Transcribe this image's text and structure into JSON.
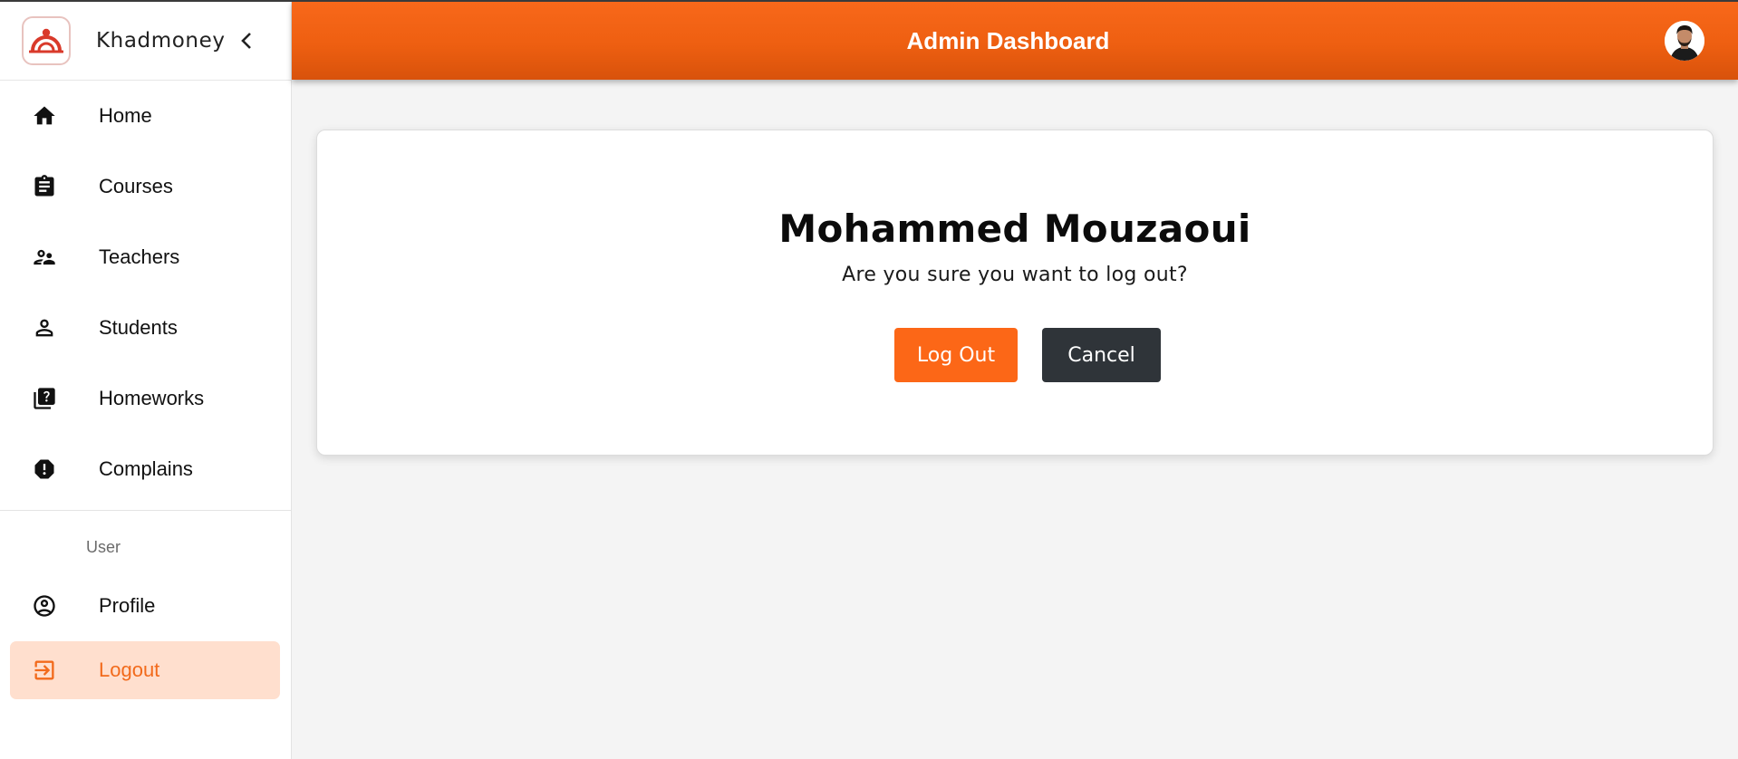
{
  "brand": {
    "name": "Khadmoney"
  },
  "header": {
    "title": "Admin Dashboard"
  },
  "nav": {
    "items": [
      {
        "label": "Home",
        "icon": "home-icon"
      },
      {
        "label": "Courses",
        "icon": "clipboard-icon"
      },
      {
        "label": "Teachers",
        "icon": "people-icon"
      },
      {
        "label": "Students",
        "icon": "person-icon"
      },
      {
        "label": "Homeworks",
        "icon": "quiz-icon"
      },
      {
        "label": "Complains",
        "icon": "report-icon"
      }
    ],
    "section_label": "User",
    "user_items": [
      {
        "label": "Profile",
        "icon": "account-circle-icon"
      },
      {
        "label": "Logout",
        "icon": "logout-icon",
        "active": true
      }
    ]
  },
  "dialog": {
    "name": "Mohammed Mouzaoui",
    "message": "Are you sure you want to log out?",
    "confirm_label": "Log Out",
    "cancel_label": "Cancel"
  },
  "colors": {
    "accent": "#f8681a",
    "active_bg": "#ffdfce",
    "cancel_bg": "#2f3439",
    "logo_red": "#d93a2b"
  }
}
